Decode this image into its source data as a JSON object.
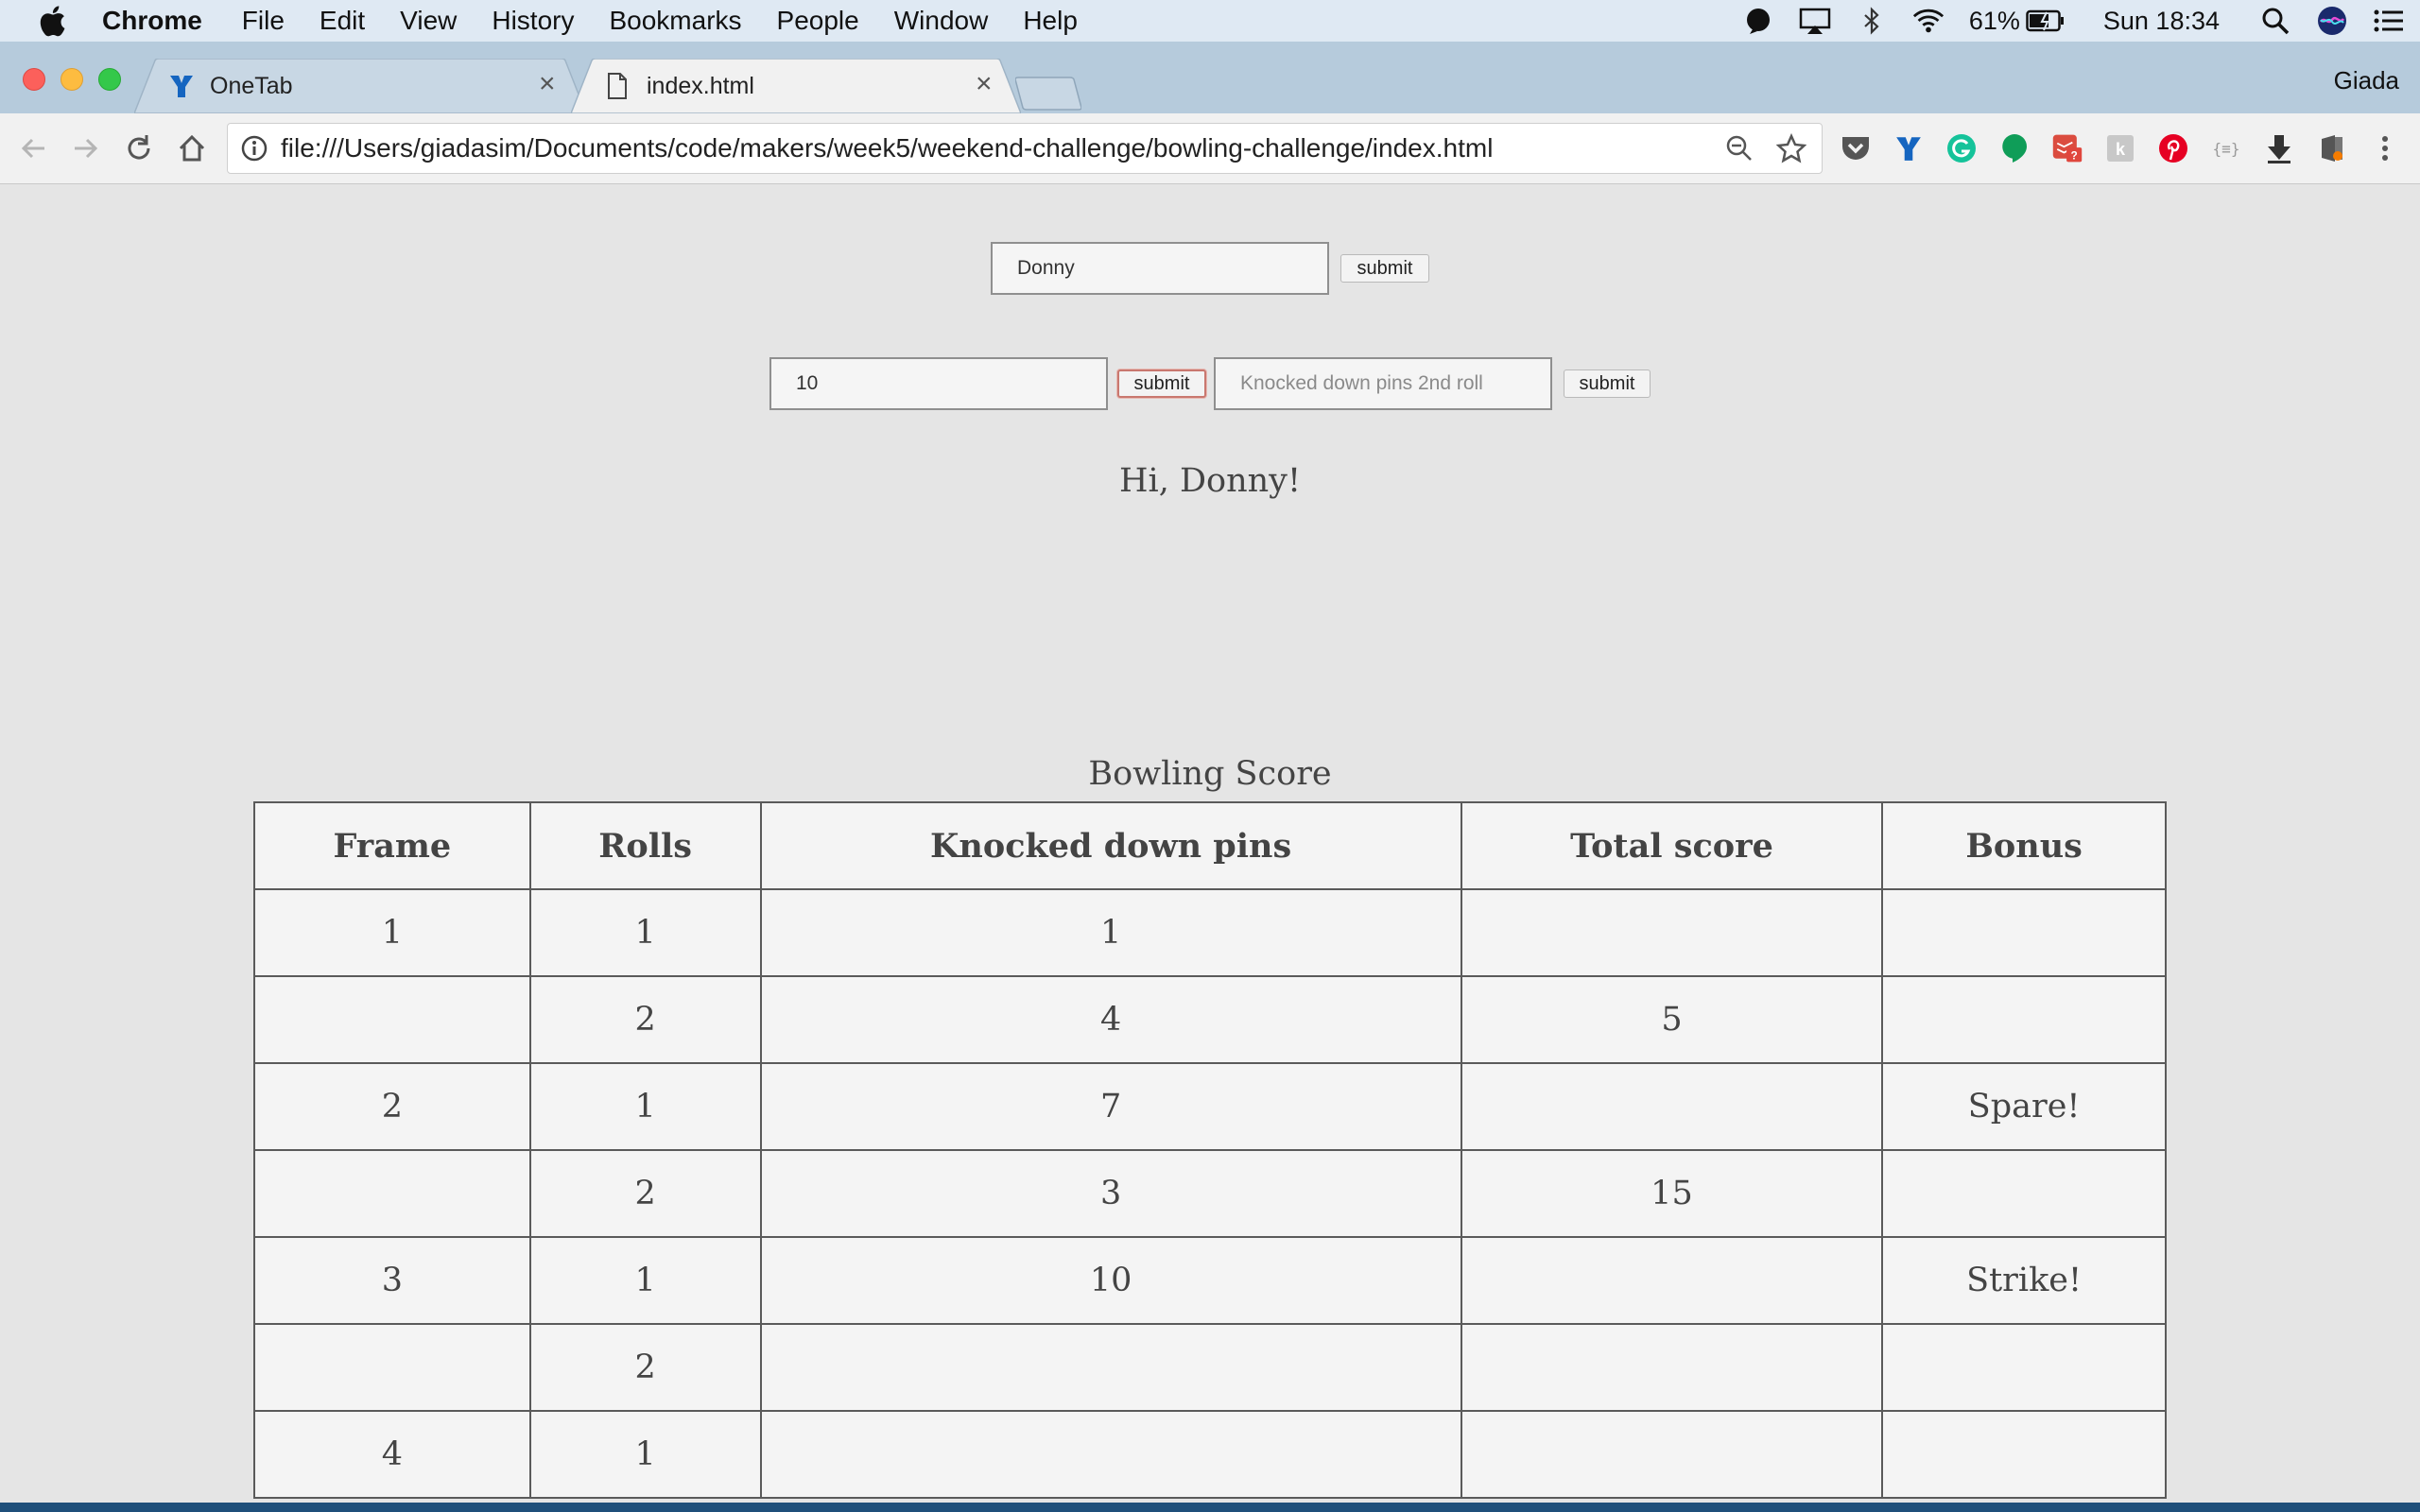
{
  "menubar": {
    "app": "Chrome",
    "items": [
      "File",
      "Edit",
      "View",
      "History",
      "Bookmarks",
      "People",
      "Window",
      "Help"
    ],
    "battery": "61%",
    "clock": "Sun 18:34",
    "icons": [
      "apple-icon",
      "app-indicator-icon",
      "airplay-icon",
      "bluetooth-icon",
      "wifi-icon",
      "battery-icon",
      "spotlight-search-icon",
      "siri-icon",
      "notification-center-icon"
    ]
  },
  "browser": {
    "tabs": [
      {
        "title": "OneTab",
        "icon": "onetab-icon"
      },
      {
        "title": "index.html",
        "icon": "document-icon"
      }
    ],
    "profile": "Giada",
    "url": "file:///Users/giadasim/Documents/code/makers/week5/weekend-challenge/bowling-challenge/index.html",
    "extensions": [
      "pocket-icon",
      "onetab-icon",
      "grammarly-icon",
      "hangouts-icon",
      "todoist-icon",
      "extension-icon",
      "pinterest-icon",
      "json-viewer-icon",
      "download-icon",
      "extension-icon"
    ]
  },
  "page": {
    "name_input": {
      "value": "Donny"
    },
    "name_submit": "submit",
    "roll1_input": {
      "value": "10"
    },
    "roll1_submit": "submit",
    "roll2_input": {
      "value": "",
      "placeholder": "Knocked down pins 2nd roll"
    },
    "roll2_submit": "submit",
    "greeting": "Hi, Donny!",
    "table": {
      "caption": "Bowling Score",
      "headers": [
        "Frame",
        "Rolls",
        "Knocked down pins",
        "Total score",
        "Bonus"
      ],
      "rows": [
        [
          "1",
          "1",
          "1",
          "",
          ""
        ],
        [
          "",
          "2",
          "4",
          "5",
          ""
        ],
        [
          "2",
          "1",
          "7",
          "",
          "Spare!"
        ],
        [
          "",
          "2",
          "3",
          "15",
          ""
        ],
        [
          "3",
          "1",
          "10",
          "",
          "Strike!"
        ],
        [
          "",
          "2",
          "",
          "",
          ""
        ],
        [
          "4",
          "1",
          "",
          "",
          ""
        ]
      ]
    }
  }
}
